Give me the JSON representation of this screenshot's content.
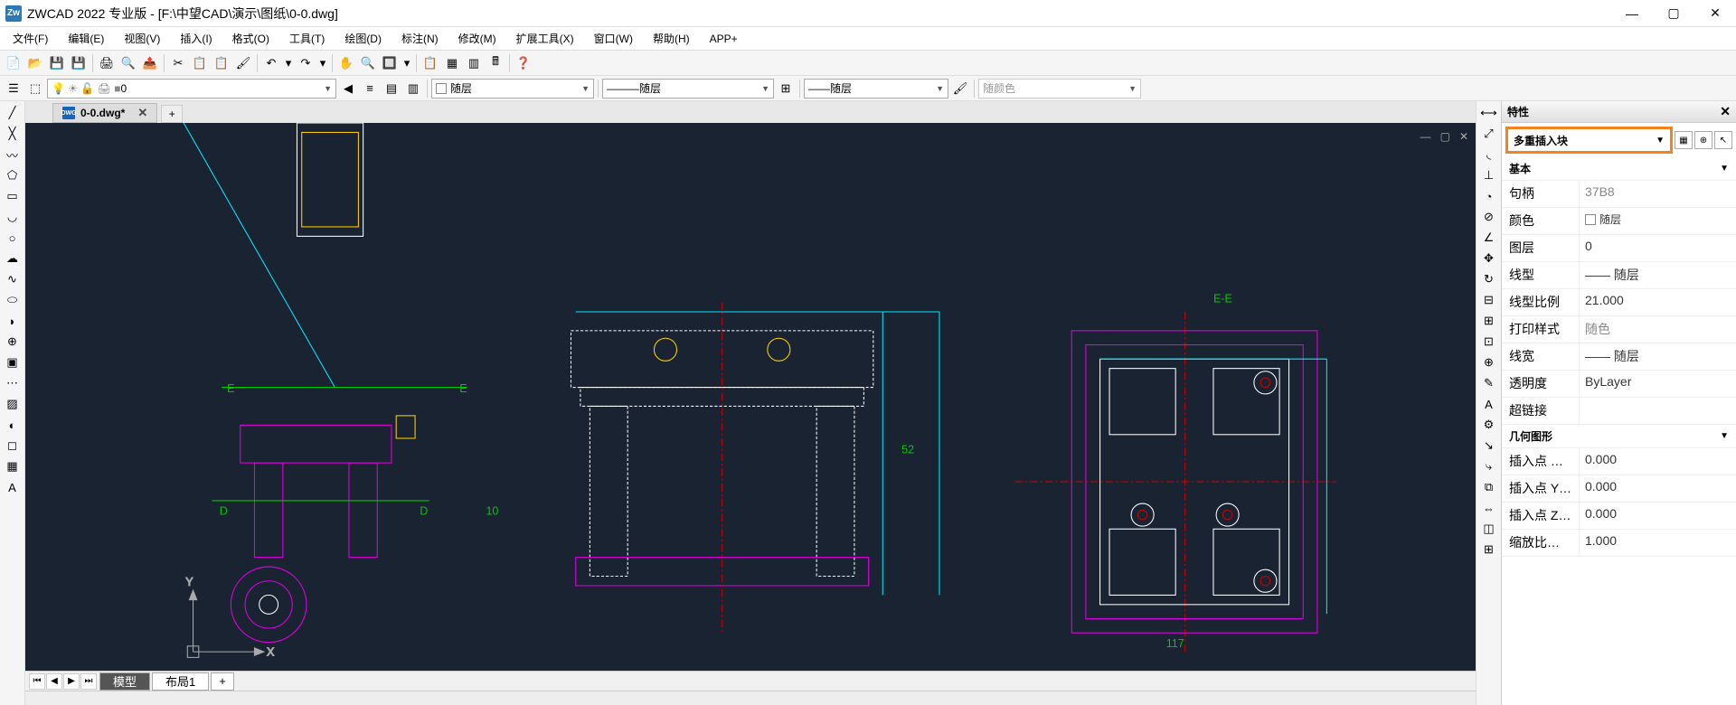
{
  "title": "ZWCAD 2022 专业版 - [F:\\中望CAD\\演示\\图纸\\0-0.dwg]",
  "app_icon_text": "Zw",
  "menu": [
    "文件(F)",
    "编辑(E)",
    "视图(V)",
    "插入(I)",
    "格式(O)",
    "工具(T)",
    "绘图(D)",
    "标注(N)",
    "修改(M)",
    "扩展工具(X)",
    "窗口(W)",
    "帮助(H)",
    "APP+"
  ],
  "layer_combo": "0",
  "prop_color": "随层",
  "prop_linetype": "随层",
  "prop_lineweight": "随层",
  "prop_color_combo": "随颜色",
  "doc_tab": "0-0.dwg*",
  "bottom_tabs": {
    "model": "模型",
    "layout1": "布局1"
  },
  "properties": {
    "title": "特性",
    "selection_type": "多重插入块",
    "sections": {
      "basic": "基本",
      "geom": "几何图形"
    },
    "rows": {
      "handle": {
        "k": "句柄",
        "v": "37B8"
      },
      "color": {
        "k": "颜色",
        "v": "随层"
      },
      "layer": {
        "k": "图层",
        "v": "0"
      },
      "ltype": {
        "k": "线型",
        "v": "—— 随层"
      },
      "ltscale": {
        "k": "线型比例",
        "v": "21.000"
      },
      "pstyle": {
        "k": "打印样式",
        "v": "随色"
      },
      "lweight": {
        "k": "线宽",
        "v": "—— 随层"
      },
      "transp": {
        "k": "透明度",
        "v": "ByLayer"
      },
      "hlink": {
        "k": "超链接",
        "v": ""
      },
      "insx": {
        "k": "插入点 X ...",
        "v": "0.000"
      },
      "insy": {
        "k": "插入点 Y ...",
        "v": "0.000"
      },
      "insz": {
        "k": "插入点 Z ...",
        "v": "0.000"
      },
      "sclx": {
        "k": "缩放比例 X",
        "v": "1.000"
      }
    }
  },
  "canvas_labels": {
    "d": "D",
    "e": "E",
    "ee": "E-E",
    "num10": "10"
  }
}
